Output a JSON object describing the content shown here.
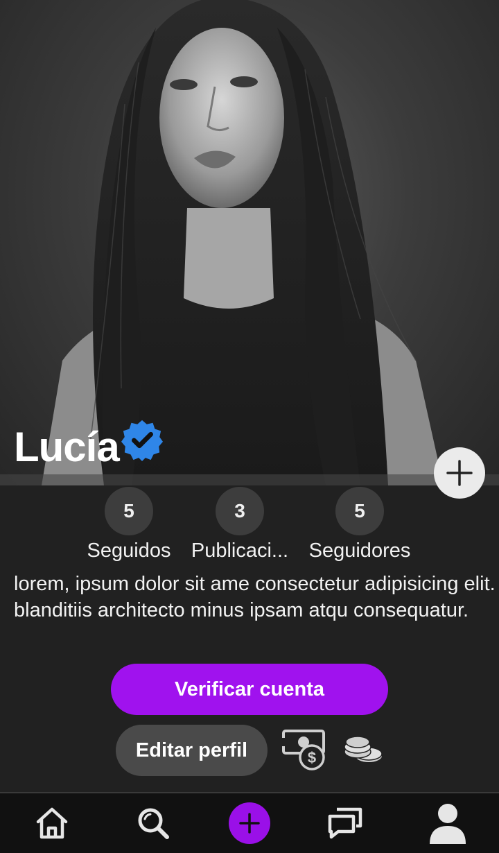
{
  "profile": {
    "name": "Lucía",
    "verified": true,
    "cover_image": "black-and-white-portrait-photo"
  },
  "stats": [
    {
      "count": "5",
      "label": "Seguidos"
    },
    {
      "count": "3",
      "label": "Publicaci..."
    },
    {
      "count": "5",
      "label": "Seguidores"
    }
  ],
  "bio": "lorem, ipsum dolor sit ame consectetur adipisicing elit. blanditiis architecto minus ipsam atqu consequatur.",
  "actions": {
    "verify_label": "Verificar cuenta",
    "edit_label": "Editar perfil"
  },
  "icons": {
    "verified": "verified-badge-icon",
    "add_photo": "plus-icon",
    "money": "money-icon",
    "coins": "coins-icon"
  },
  "nav": {
    "items": [
      "home-icon",
      "search-icon",
      "add-post-icon",
      "messages-icon",
      "profile-icon"
    ]
  },
  "colors": {
    "accent": "#a012ee",
    "background": "#212121",
    "verified_badge": "#2f86e8",
    "navbar": "#111111"
  }
}
